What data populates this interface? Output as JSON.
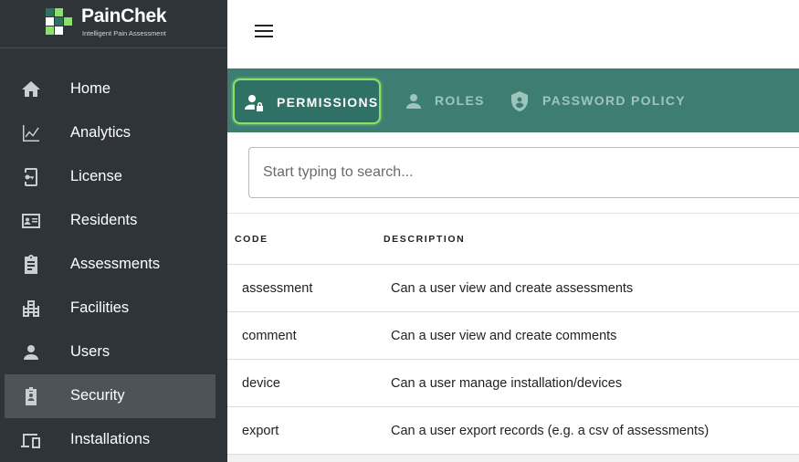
{
  "brand": {
    "name": "PainChek",
    "tagline": "Intelligent Pain Assessment",
    "colors": {
      "sidebar": "#2f3438",
      "accent": "#3e7e72",
      "highlight": "#8be06a"
    }
  },
  "sidebar": {
    "items": [
      {
        "label": "Home",
        "icon": "home-icon",
        "active": false
      },
      {
        "label": "Analytics",
        "icon": "analytics-icon",
        "active": false
      },
      {
        "label": "License",
        "icon": "license-icon",
        "active": false
      },
      {
        "label": "Residents",
        "icon": "residents-icon",
        "active": false
      },
      {
        "label": "Assessments",
        "icon": "clipboard-icon",
        "active": false
      },
      {
        "label": "Facilities",
        "icon": "building-icon",
        "active": false
      },
      {
        "label": "Users",
        "icon": "user-icon",
        "active": false
      },
      {
        "label": "Security",
        "icon": "badge-icon",
        "active": true
      },
      {
        "label": "Installations",
        "icon": "devices-icon",
        "active": false
      }
    ]
  },
  "tabs": [
    {
      "label": "PERMISSIONS",
      "icon": "user-lock-icon",
      "active": true
    },
    {
      "label": "ROLES",
      "icon": "person-icon",
      "active": false
    },
    {
      "label": "PASSWORD POLICY",
      "icon": "shield-user-icon",
      "active": false
    }
  ],
  "search": {
    "placeholder": "Start typing to search...",
    "value": ""
  },
  "table": {
    "columns": [
      "CODE",
      "DESCRIPTION"
    ],
    "rows": [
      {
        "code": "assessment",
        "description": "Can a user view and create assessments"
      },
      {
        "code": "comment",
        "description": "Can a user view and create comments"
      },
      {
        "code": "device",
        "description": "Can a user manage installation/devices"
      },
      {
        "code": "export",
        "description": "Can a user export records (e.g. a csv of assessments)"
      }
    ]
  }
}
